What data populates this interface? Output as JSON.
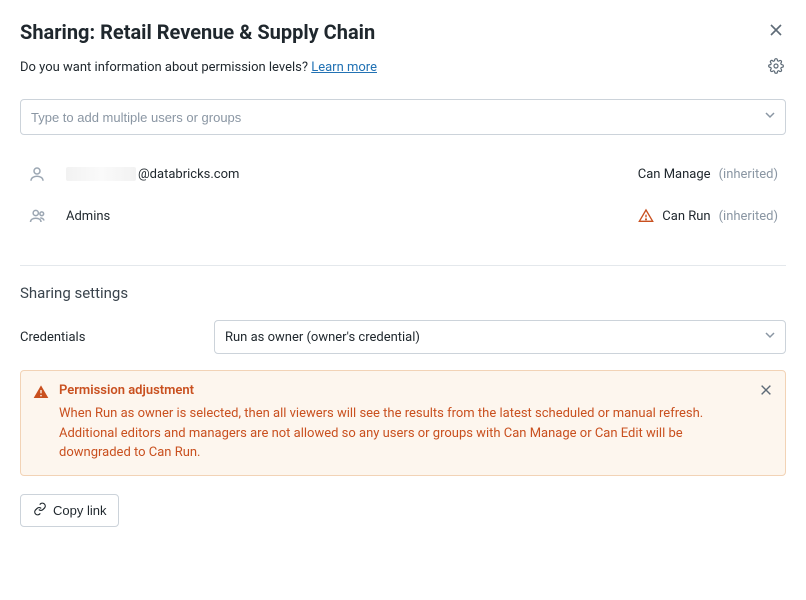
{
  "header": {
    "title": "Sharing: Retail Revenue & Supply Chain"
  },
  "info": {
    "prompt": "Do you want information about permission levels? ",
    "learn_more": "Learn more"
  },
  "search": {
    "placeholder": "Type to add multiple users or groups"
  },
  "permissions": [
    {
      "suffix": "@databricks.com",
      "level": "Can Manage",
      "inherited": "(inherited)",
      "warn": false
    },
    {
      "name": "Admins",
      "level": "Can Run",
      "inherited": "(inherited)",
      "warn": true
    }
  ],
  "settings": {
    "section_title": "Sharing settings",
    "credentials_label": "Credentials",
    "credentials_value": "Run as owner (owner's credential)"
  },
  "alert": {
    "title": "Permission adjustment",
    "body": "When Run as owner is selected, then all viewers will see the results from the latest scheduled or manual refresh. Additional editors and managers are not allowed so any users or groups with Can Manage or Can Edit will be downgraded to Can Run."
  },
  "copy_link_label": "Copy link"
}
